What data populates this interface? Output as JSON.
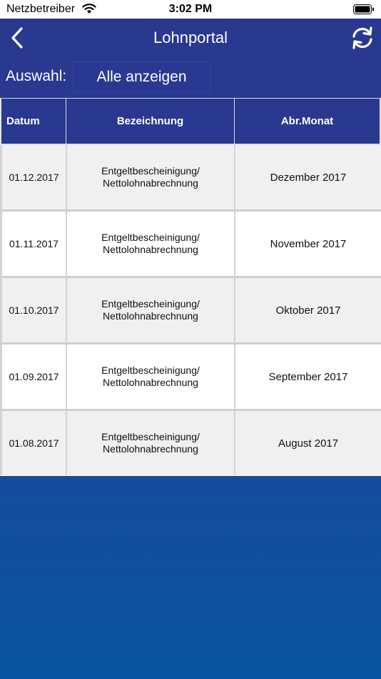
{
  "status_bar": {
    "carrier": "Netzbetreiber",
    "time": "3:02 PM"
  },
  "nav": {
    "title": "Lohnportal"
  },
  "filter": {
    "label": "Auswahl:",
    "value": "Alle anzeigen"
  },
  "table": {
    "headers": [
      "Datum",
      "Bezeichnung",
      "Abr.Monat"
    ],
    "rows": [
      {
        "date": "01.12.2017",
        "line1": "Entgeltbescheinigung/",
        "line2": "Nettolohnabrechnung",
        "month": "Dezember 2017"
      },
      {
        "date": "01.11.2017",
        "line1": "Entgeltbescheinigung/",
        "line2": "Nettolohnabrechnung",
        "month": "November 2017"
      },
      {
        "date": "01.10.2017",
        "line1": "Entgeltbescheinigung/",
        "line2": "Nettolohnabrechnung",
        "month": "Oktober 2017"
      },
      {
        "date": "01.09.2017",
        "line1": "Entgeltbescheinigung/",
        "line2": "Nettolohnabrechnung",
        "month": "September 2017"
      },
      {
        "date": "01.08.2017",
        "line1": "Entgeltbescheinigung/",
        "line2": "Nettolohnabrechnung",
        "month": "August 2017"
      }
    ]
  },
  "icons": {
    "back": "chevron-left-icon",
    "refresh": "refresh-icon",
    "wifi": "wifi-icon",
    "battery": "battery-icon"
  },
  "colors": {
    "primary": "#293990",
    "background_bottom": "#07539f",
    "row_alt": "#f0f0f0"
  }
}
